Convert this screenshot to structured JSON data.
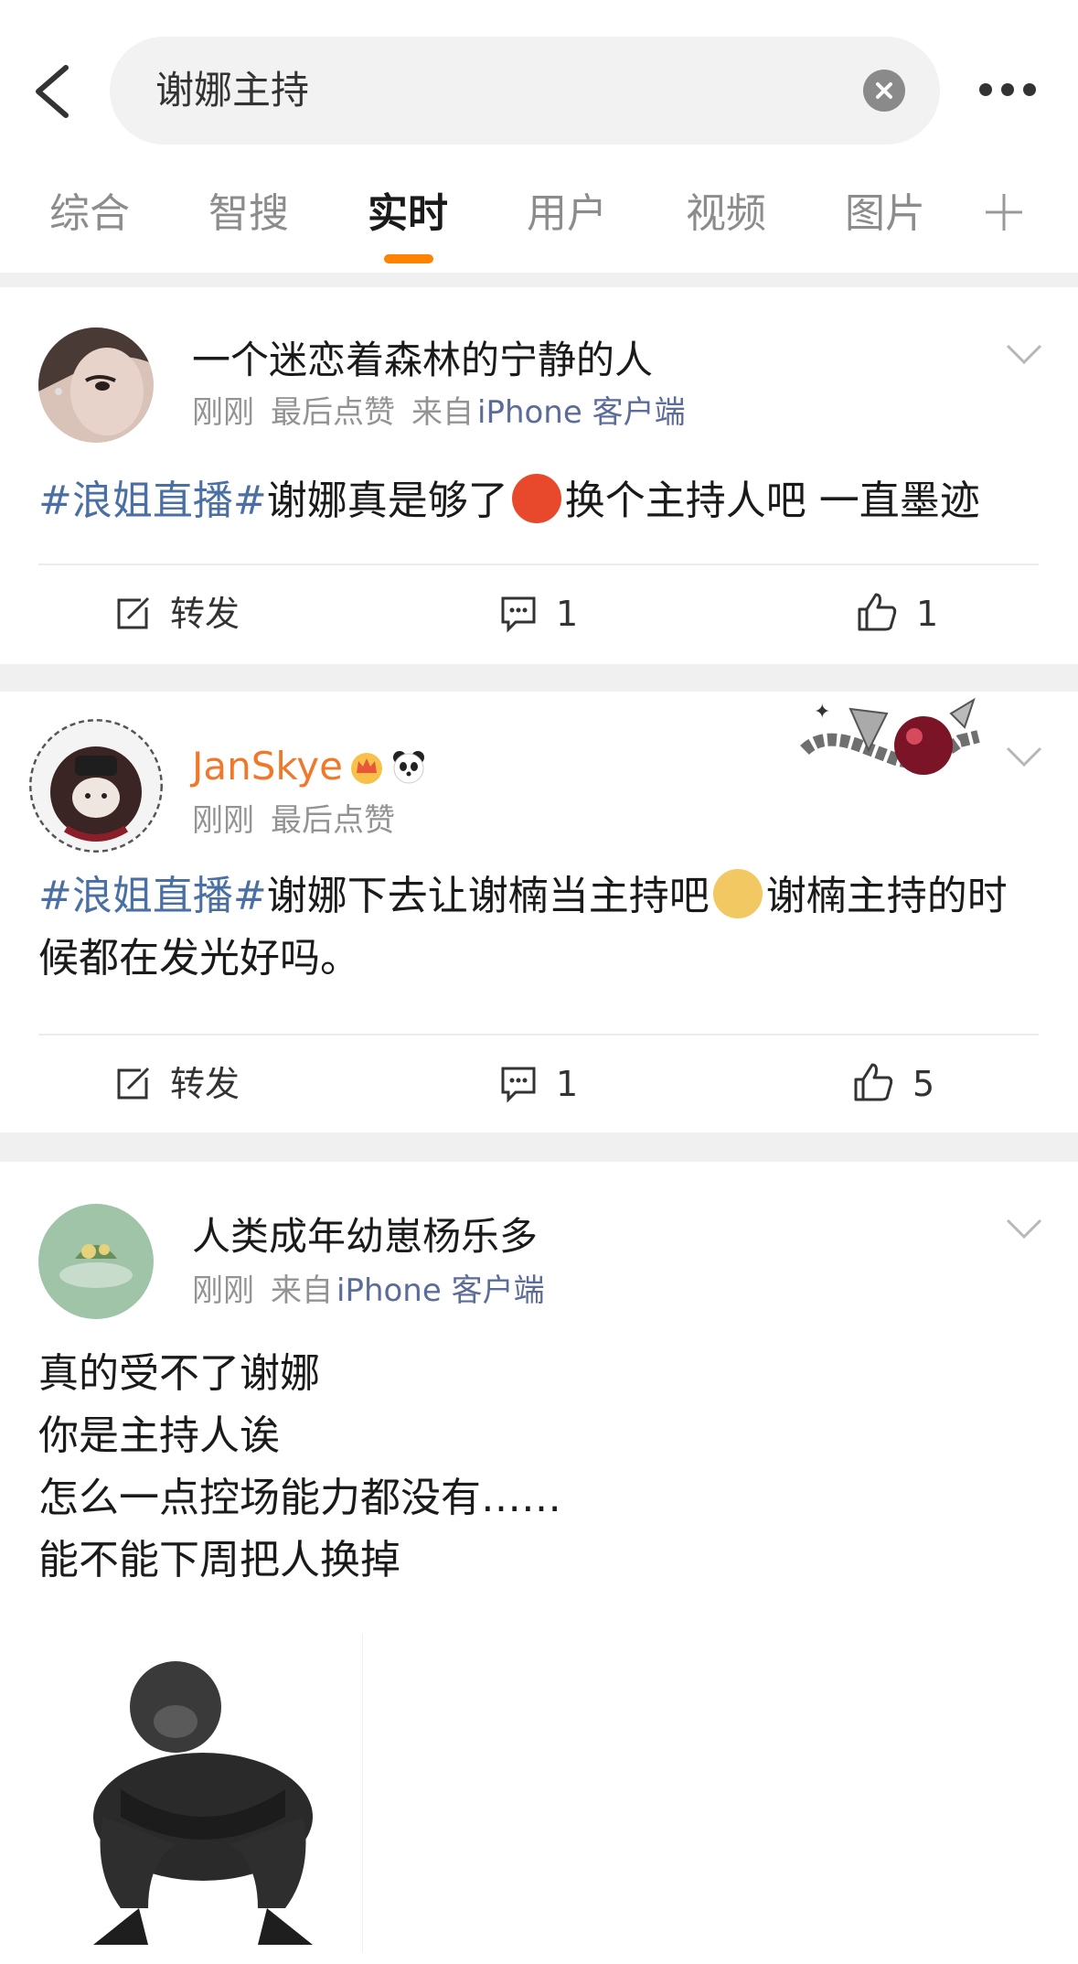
{
  "search": {
    "query": "谢娜主持"
  },
  "tabs": [
    {
      "label": "综合"
    },
    {
      "label": "智搜"
    },
    {
      "label": "实时"
    },
    {
      "label": "用户"
    },
    {
      "label": "视频"
    },
    {
      "label": "图片"
    }
  ],
  "active_tab": "实时",
  "colors": {
    "accent": "#ff8200",
    "topic_link": "#4a6fa5",
    "orange_username": "#f0782a"
  },
  "posts": [
    {
      "username": "一个迷恋着森林的宁静的人",
      "time": "刚刚",
      "liked_status": "最后点赞",
      "source_prefix": "来自",
      "source": "iPhone 客户端",
      "topic": "#浪姐直播#",
      "text_before_emoji": "谢娜真是够了",
      "emoji": "angry-face-icon",
      "text_after_emoji": "换个主持人吧 一直墨迹",
      "repost_label": "转发",
      "comments": "1",
      "likes": "1"
    },
    {
      "username": "JanSkye",
      "badges": [
        "crown-icon",
        "panda-icon"
      ],
      "time": "刚刚",
      "liked_status": "最后点赞",
      "topic": "#浪姐直播#",
      "text_before_emoji": "谢娜下去让谢楠当主持吧",
      "emoji": "doge-icon",
      "text_after_emoji": "谢楠主持的时候都在发光好吗。",
      "repost_label": "转发",
      "comments": "1",
      "likes": "5"
    },
    {
      "username": "人类成年幼崽杨乐多",
      "time": "刚刚",
      "source_prefix": "来自",
      "source": "iPhone 客户端",
      "lines": [
        "真的受不了谢娜",
        "你是主持人诶",
        "怎么一点控场能力都没有……",
        "能不能下周把人换掉"
      ]
    }
  ]
}
